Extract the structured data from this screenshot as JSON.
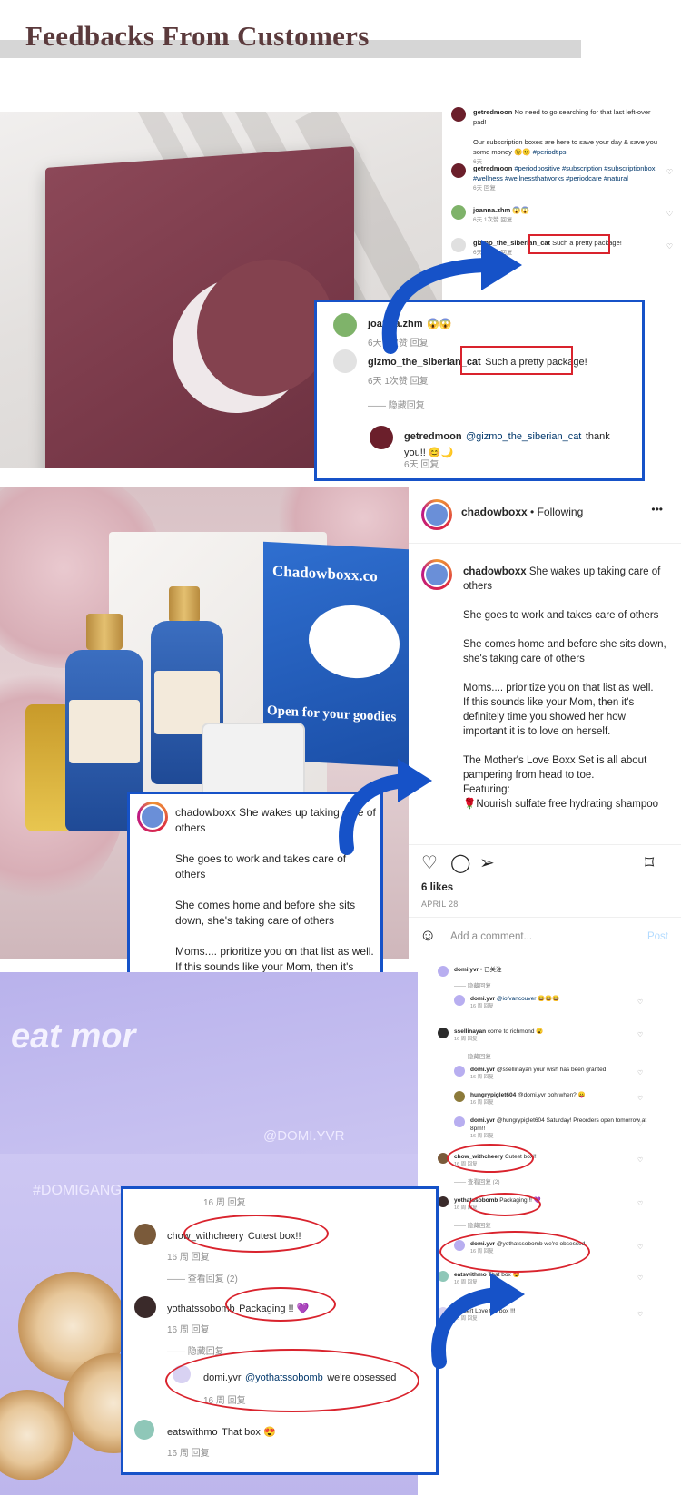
{
  "header": {
    "title": "Feedbacks From Customers"
  },
  "section1": {
    "comments": [
      {
        "user": "getredmoon",
        "text": "No need to go searching for that last left-over pad!\n\nOur subscription boxes are here to save your day & save you some money 😉🙂",
        "tag": "#periodtips",
        "meta": "6天"
      },
      {
        "user": "getredmoon",
        "text": "",
        "tag": "#periodpositive #subscription #subscriptionbox #wellness #wellnessthatworks #periodcare #natural",
        "meta": "6天   回复"
      },
      {
        "user": "joanna.zhm",
        "text": "😱😱",
        "tag": "",
        "meta": "6天   1次赞   回复"
      },
      {
        "user": "gizmo_the_siberian_cat",
        "text": "Such a pretty package!",
        "tag": "",
        "meta": "6天   1次赞   回复"
      }
    ],
    "hidden_replies": "隐藏回复",
    "zoom": {
      "c1_user": "joanna.zhm",
      "c1_text": "😱😱",
      "c1_meta": "6天  1次赞  回复",
      "c2_user": "gizmo_the_siberian_cat",
      "c2_text": "Such a pretty package!",
      "c2_meta": "6天  1次赞  回复",
      "hide": "隐藏回复",
      "c3_user": "getredmoon",
      "c3_mention": "@gizmo_the_siberian_cat",
      "c3_text": "thank you!! 😊🌙",
      "c3_meta": "6天   回复"
    }
  },
  "section2": {
    "box_title": "Chadowboxx.co",
    "box_sub": "Open for your goodies",
    "account": "chadowboxx",
    "following": "• Following",
    "more": "•••",
    "caption_user": "chadowboxx",
    "caption": "She wakes up taking care of others\n\nShe goes to work and takes care of others\n\nShe comes home and before she sits down, she's taking care of others\n\nMoms.... prioritize you on that list as well.\nIf this sounds like your Mom, then it's definitely time you showed her how important it is to love on herself.\n\nThe Mother's Love Boxx Set is all about pampering from head to toe.\nFeaturing:\n🌹Nourish sulfate free hydrating shampoo",
    "likes": "6 likes",
    "date": "APRIL 28",
    "add_comment": "Add a comment...",
    "post": "Post",
    "zoom_caption": "She wakes up taking care of others\n\nShe goes to work and takes care of others\n\nShe comes home and before she sits down, she's taking care of others\n\nMoms.... prioritize you on that list as well.\nIf this sounds like your Mom, then it's definitely time you showed her how important it is to love on herself.\n\nThe Mother's Love Boxx Set is all about pampering from head to toe.\nFeaturing:\n🌹Nourish sulfate free hydrating"
  },
  "section3": {
    "photo_text": "eat mor",
    "photo_tag1": "#DOMIGANG",
    "photo_tag2": "@DOMI.YVR",
    "thread": [
      {
        "user": "domi.yvr",
        "text": "• 已关注",
        "meta": ""
      },
      {
        "user": "",
        "text": "隐藏回复",
        "meta": ""
      },
      {
        "user": "domi.yvr",
        "text": "@iofvancouver 😀😀😀",
        "meta": "16 周   回复"
      },
      {
        "user": "ssellinayan",
        "text": "come to richmond 😮",
        "meta": "16 周   回复"
      },
      {
        "user": "",
        "text": "隐藏回复",
        "meta": ""
      },
      {
        "user": "domi.yvr",
        "text": "@ssellinayan your wish has been granted",
        "meta": "16 周   回复"
      },
      {
        "user": "hungrypiglet604",
        "text": "@domi.yvr ooh when? 😛",
        "meta": "16 周   回复"
      },
      {
        "user": "domi.yvr",
        "text": "@hungrypiglet604 Saturday! Preorders open tomorrow at 8pm!!",
        "meta": "16 周   回复"
      },
      {
        "user": "chow_withcheery",
        "text": "Cutest box!!",
        "meta": "16 周   回复"
      },
      {
        "user": "",
        "text": "查看回复 (2)",
        "meta": ""
      },
      {
        "user": "yothatssobomb",
        "text": "Packaging !! 💜",
        "meta": "16 周   回复"
      },
      {
        "user": "",
        "text": "隐藏回复",
        "meta": ""
      },
      {
        "user": "domi.yvr",
        "text": "@yothatssobomb we're obsessed",
        "meta": "16 周   回复"
      },
      {
        "user": "eatswithmo",
        "text": "That box 😍",
        "meta": "16 周   回复"
      },
      {
        "user": "",
        "text": "dessert Love the box !!!",
        "meta": "16 周   回复"
      }
    ],
    "zoom": {
      "top_meta": "16 周   回复",
      "c1_user": "chow_withcheery",
      "c1_text": "Cutest box!!",
      "c1_meta": "16 周   回复",
      "view_replies": "查看回复 (2)",
      "c2_user": "yothatssobomb",
      "c2_text": "Packaging !! 💜",
      "c2_meta": "16 周   回复",
      "hide": "隐藏回复",
      "c3_user": "domi.yvr",
      "c3_mention": "@yothatssobomb",
      "c3_text": "we're obsessed",
      "c3_meta": "16 周   回复",
      "c4_user": "eatswithmo",
      "c4_text": "That box 😍",
      "c4_meta": "16 周   回复"
    }
  },
  "colors": {
    "title": "#5b3a3c",
    "highlight_blue": "#1652c8",
    "highlight_red": "#d9232d",
    "box_maroon": "#7a3a4a",
    "lavender": "#c9c3f1"
  }
}
